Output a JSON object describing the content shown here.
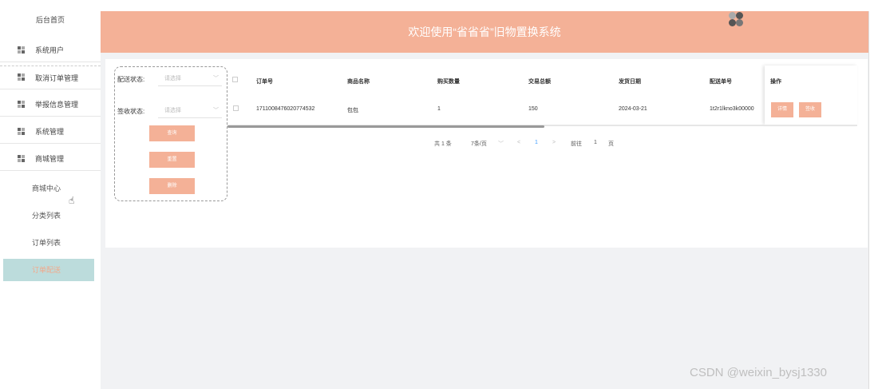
{
  "sidebar": {
    "home": "后台首页",
    "menu": [
      {
        "label": "系统用户"
      },
      {
        "label": "取消订单管理"
      },
      {
        "label": "举报信息管理"
      },
      {
        "label": "系统管理"
      },
      {
        "label": "商城管理"
      }
    ],
    "submenu": [
      {
        "label": "商城中心"
      },
      {
        "label": "分类列表"
      },
      {
        "label": "订单列表"
      },
      {
        "label": "订单配送"
      }
    ]
  },
  "header": {
    "title": "欢迎使用“省省省”旧物置换系统"
  },
  "filter": {
    "delivery_label": "配送状态:",
    "delivery_placeholder": "请选择",
    "sign_label": "签收状态:",
    "sign_placeholder": "请选择",
    "buttons": [
      "查询",
      "重置",
      "删除"
    ]
  },
  "table": {
    "headers": [
      "订单号",
      "商品名称",
      "购买数量",
      "交易总额",
      "发货日期",
      "配送单号",
      "操作"
    ],
    "rows": [
      {
        "order_no": "1711008476020774532",
        "product": "包包",
        "qty": "1",
        "total": "150",
        "ship_date": "2024-03-21",
        "tracking": "1t2r1lkno3k00000",
        "actions": [
          "详情",
          "签收"
        ]
      }
    ]
  },
  "pagination": {
    "total": "共 1 条",
    "page_size": "7条/页",
    "prev": "<",
    "current": "1",
    "next": ">",
    "goto_label": "前往",
    "goto_value": "1",
    "page_unit": "页"
  },
  "watermark": "CSDN @weixin_bysj1330",
  "colors": {
    "accent": "#f4b197",
    "active_bg": "#bcdcdc"
  }
}
